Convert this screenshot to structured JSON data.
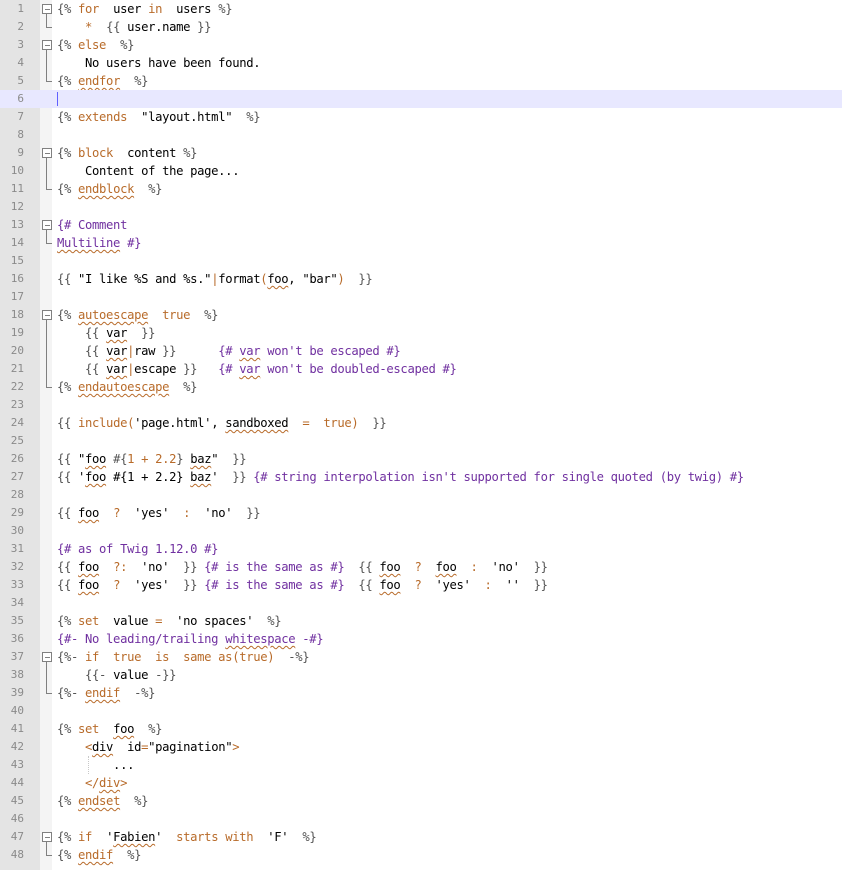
{
  "editor": {
    "active_line": 6,
    "lines": [
      {
        "n": "1",
        "fold": "start",
        "tokens": [
          [
            "del",
            "{% "
          ],
          [
            "kw",
            "for"
          ],
          [
            "",
            "  user "
          ],
          [
            "kw",
            "in"
          ],
          [
            "",
            "  users "
          ],
          [
            "del",
            "%}"
          ]
        ]
      },
      {
        "n": "2",
        "fold": "end",
        "tokens": [
          [
            "",
            "    "
          ],
          [
            "op",
            "*"
          ],
          [
            "",
            "  "
          ],
          [
            "del",
            "{{ "
          ],
          [
            "",
            "user.name "
          ],
          [
            "del",
            "}}"
          ]
        ]
      },
      {
        "n": "3",
        "fold": "start",
        "tokens": [
          [
            "del",
            "{% "
          ],
          [
            "kw",
            "else"
          ],
          [
            "",
            "  "
          ],
          [
            "del",
            "%}"
          ]
        ]
      },
      {
        "n": "4",
        "fold": "mid",
        "tokens": [
          [
            "",
            "    No users have been found."
          ]
        ]
      },
      {
        "n": "5",
        "fold": "end",
        "tokens": [
          [
            "del",
            "{% "
          ],
          [
            "kw sq",
            "endfor"
          ],
          [
            "",
            "  "
          ],
          [
            "del",
            "%}"
          ]
        ]
      },
      {
        "n": "6",
        "fold": "caret",
        "tokens": []
      },
      {
        "n": "7",
        "fold": "",
        "tokens": [
          [
            "del",
            "{% "
          ],
          [
            "kw",
            "extends"
          ],
          [
            "str",
            "  \"layout.html\""
          ],
          [
            "",
            "  "
          ],
          [
            "del",
            "%}"
          ]
        ]
      },
      {
        "n": "8",
        "fold": "",
        "tokens": []
      },
      {
        "n": "9",
        "fold": "start",
        "tokens": [
          [
            "del",
            "{% "
          ],
          [
            "kw",
            "block"
          ],
          [
            "",
            "  content "
          ],
          [
            "del",
            "%}"
          ]
        ]
      },
      {
        "n": "10",
        "fold": "mid",
        "tokens": [
          [
            "",
            "    Content of the page..."
          ]
        ]
      },
      {
        "n": "11",
        "fold": "end",
        "tokens": [
          [
            "del",
            "{% "
          ],
          [
            "kw sq",
            "endblock"
          ],
          [
            "",
            "  "
          ],
          [
            "del",
            "%}"
          ]
        ]
      },
      {
        "n": "12",
        "fold": "",
        "tokens": []
      },
      {
        "n": "13",
        "fold": "start",
        "tokens": [
          [
            "cmt",
            "{# Comment"
          ]
        ]
      },
      {
        "n": "14",
        "fold": "end-flush",
        "tokens": [
          [
            "cmt sq",
            "Multiline"
          ],
          [
            "cmt",
            " #}"
          ]
        ]
      },
      {
        "n": "15",
        "fold": "",
        "tokens": []
      },
      {
        "n": "16",
        "fold": "",
        "tokens": [
          [
            "del",
            "{{ "
          ],
          [
            "str",
            "\"I like %S and %s.\""
          ],
          [
            "kw",
            "|"
          ],
          [
            "",
            "format"
          ],
          [
            "op",
            "("
          ],
          [
            "sq",
            "foo"
          ],
          [
            "",
            ", "
          ],
          [
            "str",
            "\"bar\""
          ],
          [
            "op",
            ")"
          ],
          [
            "",
            "  "
          ],
          [
            "del",
            "}}"
          ]
        ]
      },
      {
        "n": "17",
        "fold": "",
        "tokens": []
      },
      {
        "n": "18",
        "fold": "start",
        "tokens": [
          [
            "del",
            "{% "
          ],
          [
            "kw sq",
            "autoescape"
          ],
          [
            "",
            "  "
          ],
          [
            "kw",
            "true"
          ],
          [
            "",
            "  "
          ],
          [
            "del",
            "%}"
          ]
        ]
      },
      {
        "n": "19",
        "fold": "mid",
        "tokens": [
          [
            "",
            "    "
          ],
          [
            "del",
            "{{ "
          ],
          [
            "sq",
            "var"
          ],
          [
            "",
            "  "
          ],
          [
            "del",
            "}}"
          ]
        ]
      },
      {
        "n": "20",
        "fold": "mid",
        "tokens": [
          [
            "",
            "    "
          ],
          [
            "del",
            "{{ "
          ],
          [
            "sq",
            "var"
          ],
          [
            "kw",
            "|"
          ],
          [
            "",
            "raw "
          ],
          [
            "del",
            "}}"
          ],
          [
            "",
            "      "
          ],
          [
            "cmt",
            "{# "
          ],
          [
            "cmt sq",
            "var"
          ],
          [
            "cmt",
            " won't be escaped #}"
          ]
        ]
      },
      {
        "n": "21",
        "fold": "mid",
        "tokens": [
          [
            "",
            "    "
          ],
          [
            "del",
            "{{ "
          ],
          [
            "sq",
            "var"
          ],
          [
            "kw",
            "|"
          ],
          [
            "",
            "escape "
          ],
          [
            "del",
            "}}"
          ],
          [
            "",
            "   "
          ],
          [
            "cmt",
            "{# "
          ],
          [
            "cmt sq",
            "var"
          ],
          [
            "cmt",
            " won't be doubled-escaped #}"
          ]
        ]
      },
      {
        "n": "22",
        "fold": "end",
        "tokens": [
          [
            "del",
            "{% "
          ],
          [
            "kw sq",
            "endautoescape"
          ],
          [
            "",
            "  "
          ],
          [
            "del",
            "%}"
          ]
        ]
      },
      {
        "n": "23",
        "fold": "",
        "tokens": []
      },
      {
        "n": "24",
        "fold": "",
        "tokens": [
          [
            "del",
            "{{ "
          ],
          [
            "kw",
            "include"
          ],
          [
            "op",
            "("
          ],
          [
            "str",
            "'page.html'"
          ],
          [
            "",
            ", "
          ],
          [
            "sq",
            "sandboxed"
          ],
          [
            "",
            "  "
          ],
          [
            "op",
            "="
          ],
          [
            "",
            "  "
          ],
          [
            "kw",
            "true"
          ],
          [
            "op",
            ")"
          ],
          [
            "",
            "  "
          ],
          [
            "del",
            "}}"
          ]
        ]
      },
      {
        "n": "25",
        "fold": "",
        "tokens": []
      },
      {
        "n": "26",
        "fold": "",
        "tokens": [
          [
            "del",
            "{{ "
          ],
          [
            "str",
            "\""
          ],
          [
            "str sq",
            "foo"
          ],
          [
            "str",
            " "
          ],
          [
            "del",
            "#{"
          ],
          [
            "num",
            "1"
          ],
          [
            "op",
            " + "
          ],
          [
            "num",
            "2.2"
          ],
          [
            "del",
            "}"
          ],
          [
            "str",
            " "
          ],
          [
            "str sq",
            "baz"
          ],
          [
            "str",
            "\""
          ],
          [
            "",
            "  "
          ],
          [
            "del",
            "}}"
          ]
        ]
      },
      {
        "n": "27",
        "fold": "",
        "tokens": [
          [
            "del",
            "{{ "
          ],
          [
            "str",
            "'"
          ],
          [
            "str sq",
            "foo"
          ],
          [
            "str",
            " #{1 + 2.2} "
          ],
          [
            "str sq",
            "baz"
          ],
          [
            "str",
            "'"
          ],
          [
            "",
            "  "
          ],
          [
            "del",
            "}}"
          ],
          [
            "cmt",
            " {# string interpolation isn't supported for single quoted (by twig) #}"
          ]
        ]
      },
      {
        "n": "28",
        "fold": "",
        "tokens": []
      },
      {
        "n": "29",
        "fold": "",
        "tokens": [
          [
            "del",
            "{{ "
          ],
          [
            "sq",
            "foo"
          ],
          [
            "",
            "  "
          ],
          [
            "op",
            "?"
          ],
          [
            "",
            "  "
          ],
          [
            "str",
            "'yes'"
          ],
          [
            "",
            "  "
          ],
          [
            "op",
            ":"
          ],
          [
            "",
            "  "
          ],
          [
            "str",
            "'no'"
          ],
          [
            "",
            "  "
          ],
          [
            "del",
            "}}"
          ]
        ]
      },
      {
        "n": "30",
        "fold": "",
        "tokens": []
      },
      {
        "n": "31",
        "fold": "",
        "tokens": [
          [
            "cmt",
            "{# as of Twig 1.12.0 #}"
          ]
        ]
      },
      {
        "n": "32",
        "fold": "",
        "tokens": [
          [
            "del",
            "{{ "
          ],
          [
            "sq",
            "foo"
          ],
          [
            "",
            "  "
          ],
          [
            "op",
            "?:"
          ],
          [
            "",
            "  "
          ],
          [
            "str",
            "'no'"
          ],
          [
            "",
            "  "
          ],
          [
            "del",
            "}}"
          ],
          [
            "cmt",
            " {# is the same as #}"
          ],
          [
            "",
            "  "
          ],
          [
            "del",
            "{{ "
          ],
          [
            "sq",
            "foo"
          ],
          [
            "",
            "  "
          ],
          [
            "op",
            "?"
          ],
          [
            "",
            "  "
          ],
          [
            "sq",
            "foo"
          ],
          [
            "",
            "  "
          ],
          [
            "op",
            ":"
          ],
          [
            "",
            "  "
          ],
          [
            "str",
            "'no'"
          ],
          [
            "",
            "  "
          ],
          [
            "del",
            "}}"
          ]
        ]
      },
      {
        "n": "33",
        "fold": "",
        "tokens": [
          [
            "del",
            "{{ "
          ],
          [
            "sq",
            "foo"
          ],
          [
            "",
            "  "
          ],
          [
            "op",
            "?"
          ],
          [
            "",
            "  "
          ],
          [
            "str",
            "'yes'"
          ],
          [
            "",
            "  "
          ],
          [
            "del",
            "}}"
          ],
          [
            "cmt",
            " {# is the same as #}"
          ],
          [
            "",
            "  "
          ],
          [
            "del",
            "{{ "
          ],
          [
            "sq",
            "foo"
          ],
          [
            "",
            "  "
          ],
          [
            "op",
            "?"
          ],
          [
            "",
            "  "
          ],
          [
            "str",
            "'yes'"
          ],
          [
            "",
            "  "
          ],
          [
            "op",
            ":"
          ],
          [
            "",
            "  "
          ],
          [
            "str",
            "''"
          ],
          [
            "",
            "  "
          ],
          [
            "del",
            "}}"
          ]
        ]
      },
      {
        "n": "34",
        "fold": "",
        "tokens": []
      },
      {
        "n": "35",
        "fold": "",
        "tokens": [
          [
            "del",
            "{% "
          ],
          [
            "kw",
            "set"
          ],
          [
            "",
            "  value "
          ],
          [
            "op",
            "="
          ],
          [
            "",
            "  "
          ],
          [
            "str",
            "'no spaces'"
          ],
          [
            "",
            "  "
          ],
          [
            "del",
            "%}"
          ]
        ]
      },
      {
        "n": "36",
        "fold": "",
        "tokens": [
          [
            "cmt",
            "{#- No leading/trailing "
          ],
          [
            "cmt sq",
            "whitespace"
          ],
          [
            "cmt",
            " -#}"
          ]
        ]
      },
      {
        "n": "37",
        "fold": "start",
        "tokens": [
          [
            "del",
            "{%- "
          ],
          [
            "kw",
            "if"
          ],
          [
            "",
            "  "
          ],
          [
            "kw",
            "true"
          ],
          [
            "",
            "  "
          ],
          [
            "kw",
            "is"
          ],
          [
            "",
            "  "
          ],
          [
            "kw",
            "same as"
          ],
          [
            "op",
            "("
          ],
          [
            "kw",
            "true"
          ],
          [
            "op",
            ")"
          ],
          [
            "",
            "  "
          ],
          [
            "del",
            "-%}"
          ]
        ]
      },
      {
        "n": "38",
        "fold": "mid",
        "tokens": [
          [
            "",
            "    "
          ],
          [
            "del",
            "{{- "
          ],
          [
            "",
            "value "
          ],
          [
            "del",
            "-}}"
          ]
        ]
      },
      {
        "n": "39",
        "fold": "end",
        "tokens": [
          [
            "del",
            "{%- "
          ],
          [
            "kw sq",
            "endif"
          ],
          [
            "",
            "  "
          ],
          [
            "del",
            "-%}"
          ]
        ]
      },
      {
        "n": "40",
        "fold": "",
        "tokens": []
      },
      {
        "n": "41",
        "fold": "",
        "tokens": [
          [
            "del",
            "{% "
          ],
          [
            "kw",
            "set"
          ],
          [
            "",
            "  "
          ],
          [
            "sq",
            "foo"
          ],
          [
            "",
            "  "
          ],
          [
            "del",
            "%}"
          ]
        ]
      },
      {
        "n": "42",
        "fold": "",
        "tokens": [
          [
            "",
            "    "
          ],
          [
            "tag",
            "<"
          ],
          [
            "sq",
            "div"
          ],
          [
            "",
            "  id"
          ],
          [
            "op",
            "="
          ],
          [
            "str",
            "\"pagination\""
          ],
          [
            "tag",
            ">"
          ]
        ]
      },
      {
        "n": "43",
        "fold": "guide",
        "tokens": [
          [
            "",
            "        ..."
          ]
        ]
      },
      {
        "n": "44",
        "fold": "",
        "tokens": [
          [
            "",
            "    "
          ],
          [
            "tag",
            "</"
          ],
          [
            "tag sq",
            "div"
          ],
          [
            "tag",
            ">"
          ]
        ]
      },
      {
        "n": "45",
        "fold": "",
        "tokens": [
          [
            "del",
            "{% "
          ],
          [
            "kw sq",
            "endset"
          ],
          [
            "",
            "  "
          ],
          [
            "del",
            "%}"
          ]
        ]
      },
      {
        "n": "46",
        "fold": "",
        "tokens": []
      },
      {
        "n": "47",
        "fold": "start",
        "tokens": [
          [
            "del",
            "{% "
          ],
          [
            "kw",
            "if"
          ],
          [
            "",
            "  "
          ],
          [
            "str",
            "'"
          ],
          [
            "str sq",
            "Fabien"
          ],
          [
            "str",
            "'"
          ],
          [
            "",
            "  "
          ],
          [
            "kw",
            "starts with"
          ],
          [
            "",
            "  "
          ],
          [
            "str",
            "'F'"
          ],
          [
            "",
            "  "
          ],
          [
            "del",
            "%}"
          ]
        ]
      },
      {
        "n": "48",
        "fold": "end",
        "tokens": [
          [
            "del",
            "{% "
          ],
          [
            "kw sq",
            "endif"
          ],
          [
            "",
            "  "
          ],
          [
            "del",
            "%}"
          ]
        ]
      }
    ]
  }
}
